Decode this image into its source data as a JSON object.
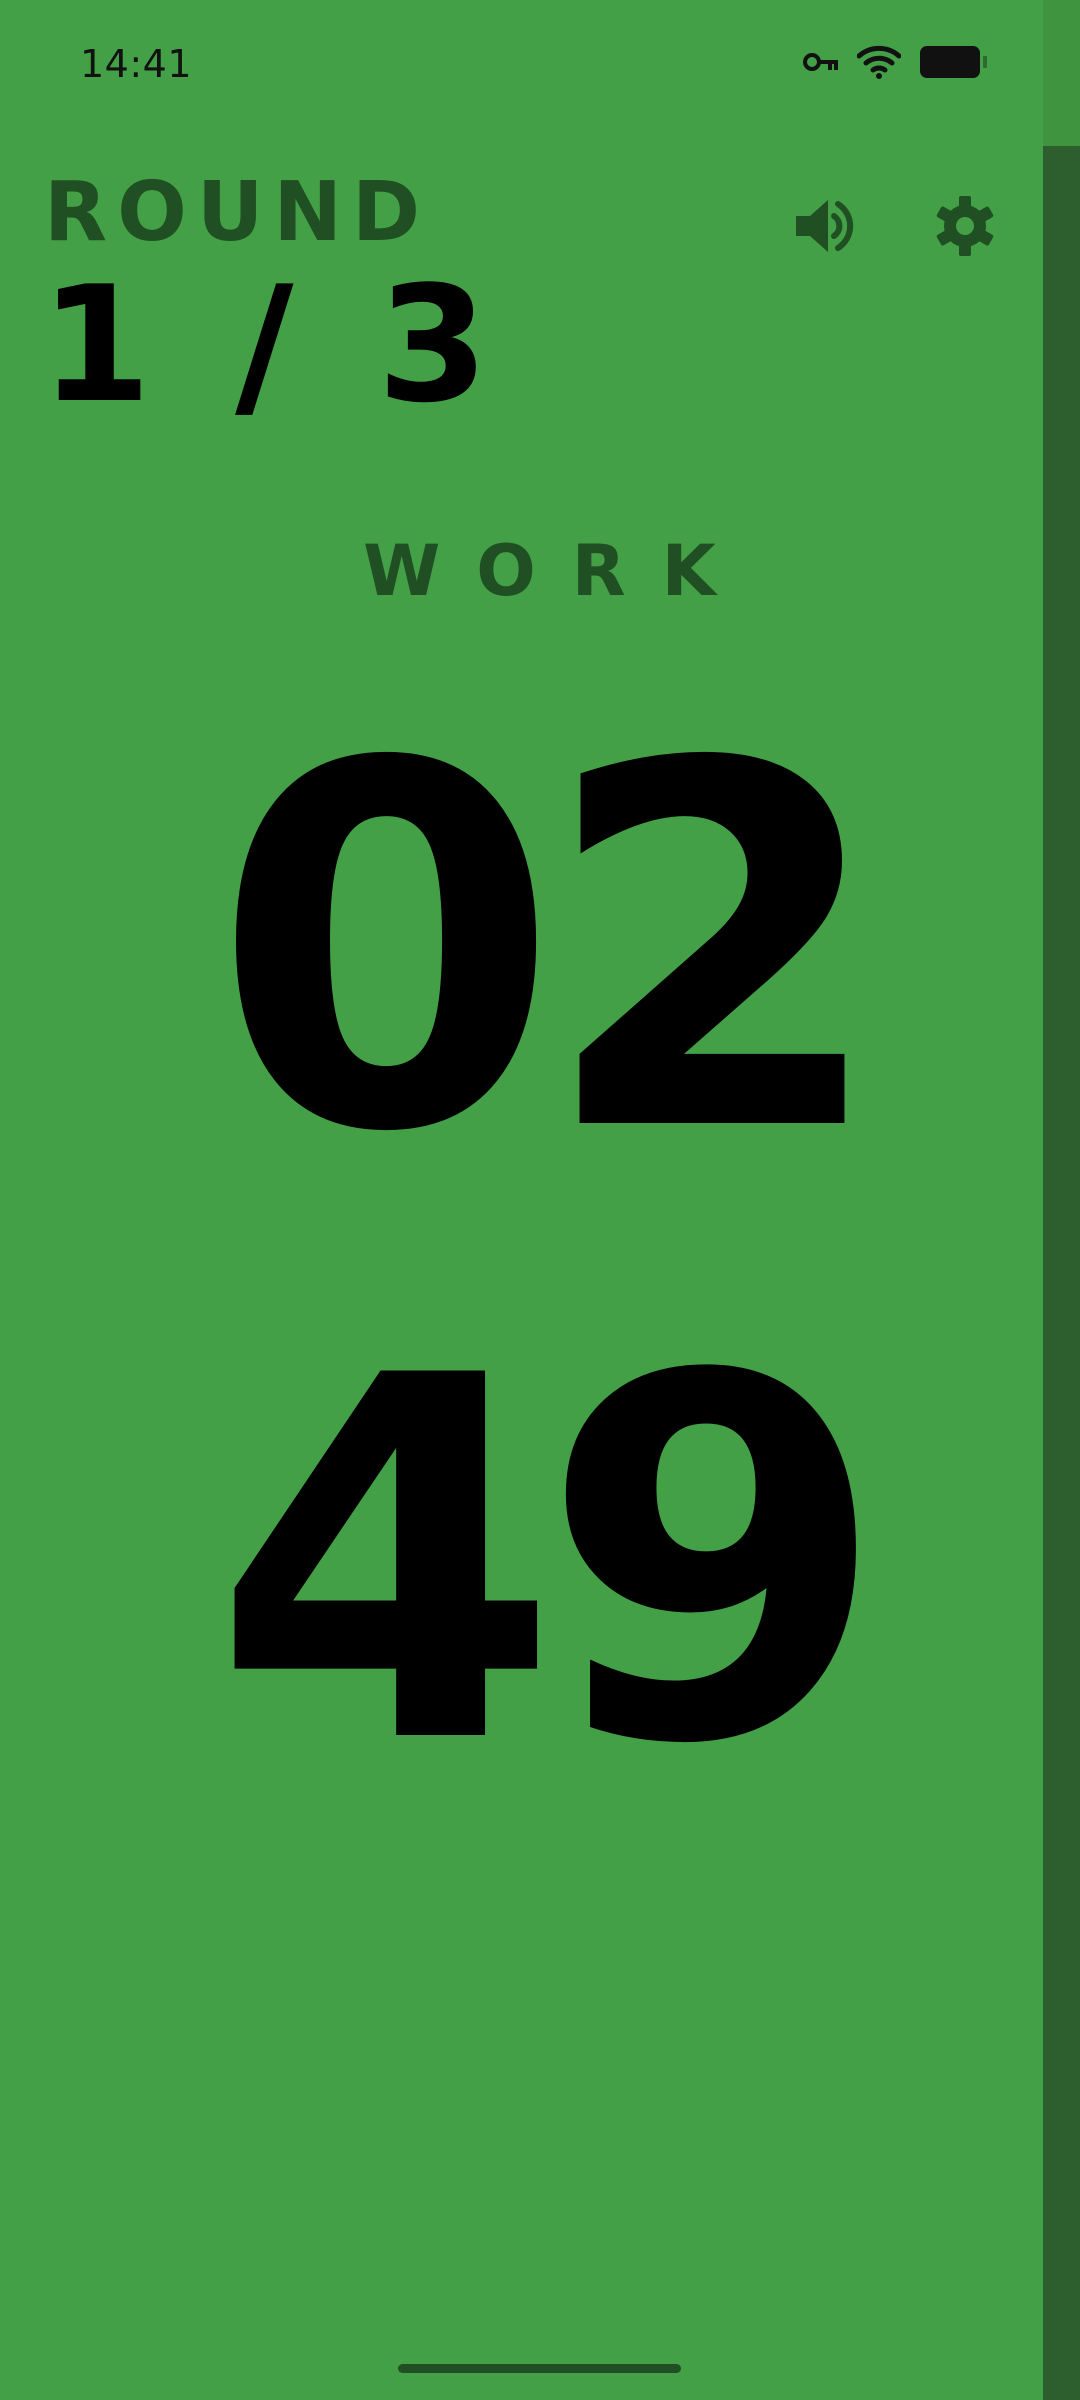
{
  "status_bar": {
    "time": "14:41",
    "icons": [
      "vpn-key-icon",
      "wifi-icon",
      "battery-icon"
    ]
  },
  "header": {
    "round_label": "ROUND",
    "round_count": "1 / 3",
    "actions": [
      "volume-icon",
      "settings-icon"
    ]
  },
  "phase": {
    "label": "WORK"
  },
  "timer": {
    "minutes": "02",
    "seconds": "49"
  },
  "colors": {
    "background": "#43a047",
    "dark_accent": "#1f4f22",
    "rail": "#2c5e2e"
  }
}
